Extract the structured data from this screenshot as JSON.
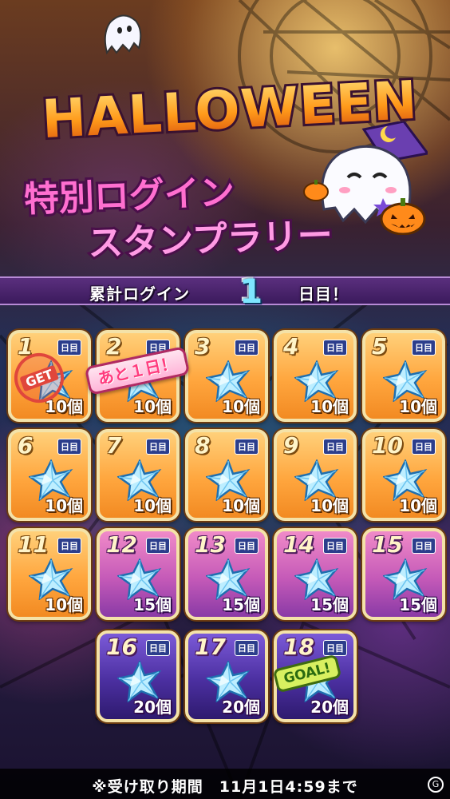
{
  "header": {
    "title": "HALLOWEEN",
    "subtitle_line1": "特別ログイン",
    "subtitle_line2": "スタンプラリー"
  },
  "login_counter": {
    "prefix": "累計ログイン",
    "days": "1",
    "suffix": "日目！"
  },
  "day_suffix": "日目",
  "stamps": [
    {
      "day": "1",
      "amount": "10個",
      "color": "orange"
    },
    {
      "day": "2",
      "amount": "10個",
      "color": "orange"
    },
    {
      "day": "3",
      "amount": "10個",
      "color": "orange"
    },
    {
      "day": "4",
      "amount": "10個",
      "color": "orange"
    },
    {
      "day": "5",
      "amount": "10個",
      "color": "orange"
    },
    {
      "day": "6",
      "amount": "10個",
      "color": "orange"
    },
    {
      "day": "7",
      "amount": "10個",
      "color": "orange"
    },
    {
      "day": "8",
      "amount": "10個",
      "color": "orange"
    },
    {
      "day": "9",
      "amount": "10個",
      "color": "orange"
    },
    {
      "day": "10",
      "amount": "10個",
      "color": "orange"
    },
    {
      "day": "11",
      "amount": "10個",
      "color": "orange"
    },
    {
      "day": "12",
      "amount": "15個",
      "color": "pink"
    },
    {
      "day": "13",
      "amount": "15個",
      "color": "pink"
    },
    {
      "day": "14",
      "amount": "15個",
      "color": "pink"
    },
    {
      "day": "15",
      "amount": "15個",
      "color": "pink"
    },
    {
      "day": "16",
      "amount": "20個",
      "color": "purple"
    },
    {
      "day": "17",
      "amount": "20個",
      "color": "purple"
    },
    {
      "day": "18",
      "amount": "20個",
      "color": "purple"
    }
  ],
  "badges": {
    "get": "GET",
    "remaining": "あと１日！",
    "goal": "GOAL!"
  },
  "footer": {
    "note": "※受け取り期間　11月1日4:59まで"
  },
  "corner_logo": "G",
  "colors": {
    "orange_card": "#ffa63e",
    "pink_card": "#c55ab8",
    "purple_card": "#4b2fa0",
    "banner": "#3b1a5c",
    "counter_number": "#7ee6ff"
  },
  "icons": [
    "gem-star-icon",
    "ghost-icon",
    "witch-ghost-icon",
    "pumpkin-icon",
    "get-stamp-icon"
  ]
}
